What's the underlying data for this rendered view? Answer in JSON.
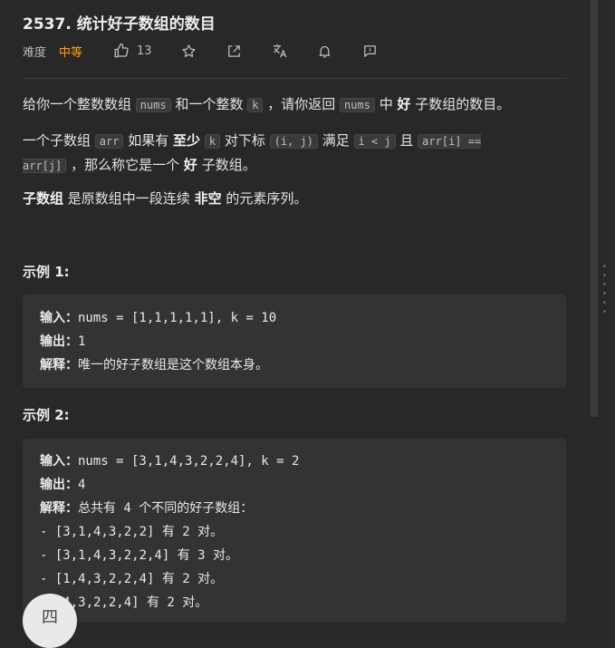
{
  "problem": {
    "title": "2537. 统计好子数组的数目",
    "difficulty_label": "难度",
    "difficulty": "中等",
    "like_count": "13"
  },
  "toolbar": {
    "icons": [
      "thumbs-up-icon",
      "star-icon",
      "share-icon",
      "translate-icon",
      "bell-icon",
      "feedback-icon"
    ]
  },
  "description": {
    "p1": {
      "t1": "给你一个整数数组 ",
      "c1": "nums",
      "t2": " 和一个整数 ",
      "c2": "k",
      "t3": " ，请你返回 ",
      "c3": "nums",
      "t4": " 中 ",
      "b1": "好",
      "t5": " 子数组的数目。"
    },
    "p2": {
      "t1": "一个子数组 ",
      "c1": "arr",
      "t2": " 如果有 ",
      "b1": "至少",
      "t3": " ",
      "c2": "k",
      "t4": " 对下标 ",
      "c3": "(i, j)",
      "t5": " 满足 ",
      "c4": "i < j",
      "t6": " 且 ",
      "c5": "arr[i] == arr[j]",
      "t7": " ，那么称它是一个 ",
      "b2": "好",
      "t8": " 子数组。"
    },
    "p3": {
      "b1": "子数组",
      "t1": " 是原数组中一段连续 ",
      "b2": "非空",
      "t2": " 的元素序列。"
    }
  },
  "examples": [
    {
      "title": "示例 1:",
      "input_label": "输入：",
      "input": "nums = [1,1,1,1,1], k = 10",
      "output_label": "输出：",
      "output": "1",
      "explain_label": "解释：",
      "explain": "唯一的好子数组是这个数组本身。"
    },
    {
      "title": "示例 2:",
      "input_label": "输入：",
      "input": "nums = [3,1,4,3,2,2,4], k = 2",
      "output_label": "输出：",
      "output": "4",
      "explain_label": "解释：",
      "explain": "总共有 4 个不同的好子数组：",
      "items": [
        "- [3,1,4,3,2,2] 有 2 对。",
        "- [3,1,4,3,2,2,4] 有 3 对。",
        "- [1,4,3,2,2,4] 有 2 对。",
        "- [4,3,2,2,4] 有 2 对。"
      ]
    }
  ],
  "fab": {
    "label": "四"
  }
}
